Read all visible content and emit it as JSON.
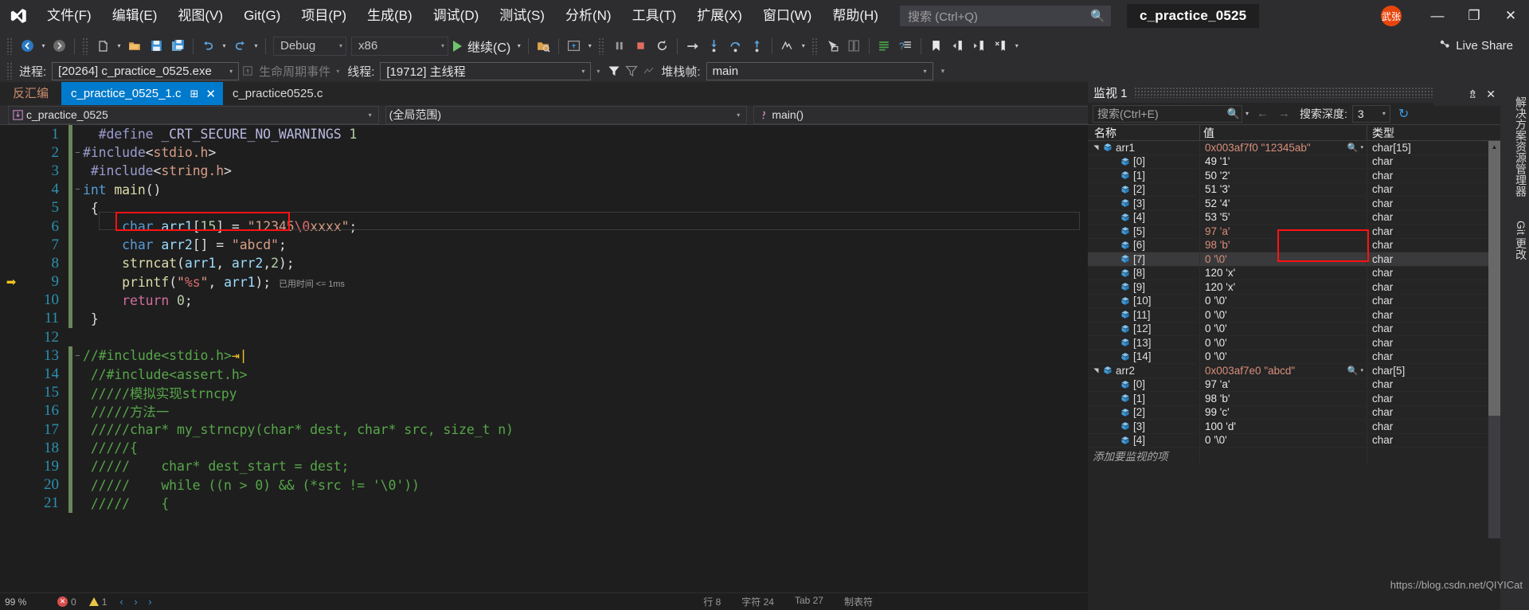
{
  "titlebar": {
    "logo": "visual-studio-logo",
    "menus": [
      "文件(F)",
      "编辑(E)",
      "视图(V)",
      "Git(G)",
      "项目(P)",
      "生成(B)",
      "调试(D)",
      "测试(S)",
      "分析(N)",
      "工具(T)",
      "扩展(X)",
      "窗口(W)",
      "帮助(H)"
    ],
    "search_placeholder": "搜索 (Ctrl+Q)",
    "project_chip": "c_practice_0525",
    "avatar_text": "武张",
    "minimize": "—",
    "restore": "❐",
    "close": "✕"
  },
  "toolbar": {
    "config": "Debug",
    "platform": "x86",
    "continue_label": "继续(C)",
    "live_share": "Live Share"
  },
  "debugbar": {
    "process_label": "进程:",
    "process_value": "[20264] c_practice_0525.exe",
    "lifecycle_label": "生命周期事件",
    "thread_label": "线程:",
    "thread_value": "[19712] 主线程",
    "stackframe_label": "堆栈帧:",
    "stackframe_value": "main"
  },
  "editor": {
    "disasm_tab": "反汇编",
    "tabs": [
      {
        "label": "c_practice_0525_1.c",
        "active": true,
        "pin": "⊞",
        "close": "✕"
      },
      {
        "label": "c_practice0525.c",
        "active": false
      }
    ],
    "nav": {
      "project": "c_practice_0525",
      "scope": "(全局范围)",
      "member": "main()"
    },
    "elapsed_hint": "已用时间 <= 1ms",
    "lines": [
      {
        "n": 1,
        "fold": "",
        "changed": true,
        "tokens": [
          [
            "k-pre",
            "  #define "
          ],
          [
            "k-macro",
            "_CRT_SECURE_NO_WARNINGS"
          ],
          [
            "k-plain",
            " "
          ],
          [
            "k-num",
            "1"
          ]
        ]
      },
      {
        "n": 2,
        "fold": "−",
        "changed": true,
        "tokens": [
          [
            "k-pre",
            "#include"
          ],
          [
            "k-plain",
            "<"
          ],
          [
            "k-inc",
            "stdio.h"
          ],
          [
            "k-plain",
            ">"
          ]
        ]
      },
      {
        "n": 3,
        "fold": "",
        "changed": true,
        "tokens": [
          [
            "k-pre",
            " #include"
          ],
          [
            "k-plain",
            "<"
          ],
          [
            "k-inc",
            "string.h"
          ],
          [
            "k-plain",
            ">"
          ]
        ]
      },
      {
        "n": 4,
        "fold": "−",
        "changed": true,
        "tokens": [
          [
            "k-type",
            "int "
          ],
          [
            "k-fn",
            "main"
          ],
          [
            "k-plain",
            "()"
          ]
        ]
      },
      {
        "n": 5,
        "fold": "",
        "changed": true,
        "tokens": [
          [
            "k-plain",
            " {"
          ]
        ]
      },
      {
        "n": 6,
        "fold": "",
        "changed": true,
        "tokens": [
          [
            "k-plain",
            "     "
          ],
          [
            "k-type",
            "char"
          ],
          [
            "k-plain",
            " "
          ],
          [
            "k-var",
            "arr1"
          ],
          [
            "k-plain",
            "["
          ],
          [
            "k-num",
            "15"
          ],
          [
            "k-plain",
            "] = "
          ],
          [
            "k-str",
            "\"12345"
          ],
          [
            "k-esc",
            "\\0"
          ],
          [
            "k-str",
            "xxxx\""
          ],
          [
            "k-plain",
            ";"
          ]
        ]
      },
      {
        "n": 7,
        "fold": "",
        "changed": true,
        "tokens": [
          [
            "k-plain",
            "     "
          ],
          [
            "k-type",
            "char"
          ],
          [
            "k-plain",
            " "
          ],
          [
            "k-var",
            "arr2"
          ],
          [
            "k-plain",
            "[] = "
          ],
          [
            "k-str",
            "\"abcd\""
          ],
          [
            "k-plain",
            ";"
          ]
        ]
      },
      {
        "n": 8,
        "fold": "",
        "changed": true,
        "tokens": [
          [
            "k-plain",
            "     "
          ],
          [
            "k-fn",
            "strncat"
          ],
          [
            "k-plain",
            "("
          ],
          [
            "k-var",
            "arr1"
          ],
          [
            "k-plain",
            ", "
          ],
          [
            "k-var",
            "arr2"
          ],
          [
            "k-plain",
            ","
          ],
          [
            "k-num",
            "2"
          ],
          [
            "k-plain",
            ");"
          ]
        ]
      },
      {
        "n": 9,
        "fold": "",
        "changed": true,
        "current": true,
        "tokens": [
          [
            "k-plain",
            "     "
          ],
          [
            "k-fn",
            "printf"
          ],
          [
            "k-plain",
            "("
          ],
          [
            "k-str",
            "\""
          ],
          [
            "k-esc",
            "%s"
          ],
          [
            "k-str",
            "\""
          ],
          [
            "k-plain",
            ", "
          ],
          [
            "k-var",
            "arr1"
          ],
          [
            "k-plain",
            ");"
          ]
        ],
        "hint": true
      },
      {
        "n": 10,
        "fold": "",
        "changed": true,
        "tokens": [
          [
            "k-plain",
            "     "
          ],
          [
            "k-kw",
            "return"
          ],
          [
            "k-plain",
            " "
          ],
          [
            "k-num",
            "0"
          ],
          [
            "k-plain",
            ";"
          ]
        ]
      },
      {
        "n": 11,
        "fold": "",
        "changed": true,
        "tokens": [
          [
            "k-plain",
            " }"
          ]
        ]
      },
      {
        "n": 12,
        "fold": "",
        "changed": false,
        "tokens": [
          [
            "k-plain",
            ""
          ]
        ]
      },
      {
        "n": 13,
        "fold": "−",
        "changed": true,
        "tokens": [
          [
            "k-cmt",
            "//#include<stdio.h>"
          ]
        ],
        "caret": true
      },
      {
        "n": 14,
        "fold": "",
        "changed": true,
        "tokens": [
          [
            "k-cmt",
            " //#include<assert.h>"
          ]
        ]
      },
      {
        "n": 15,
        "fold": "",
        "changed": true,
        "tokens": [
          [
            "k-cmt",
            " /////模拟实现strncpy"
          ]
        ]
      },
      {
        "n": 16,
        "fold": "",
        "changed": true,
        "tokens": [
          [
            "k-cmt",
            " /////方法一"
          ]
        ]
      },
      {
        "n": 17,
        "fold": "",
        "changed": true,
        "tokens": [
          [
            "k-cmt",
            " /////char* my_strncpy(char* dest, char* src, size_t n)"
          ]
        ]
      },
      {
        "n": 18,
        "fold": "",
        "changed": true,
        "tokens": [
          [
            "k-cmt",
            " /////{"
          ]
        ]
      },
      {
        "n": 19,
        "fold": "",
        "changed": true,
        "tokens": [
          [
            "k-cmt",
            " /////    char* dest_start = dest;"
          ]
        ]
      },
      {
        "n": 20,
        "fold": "",
        "changed": true,
        "tokens": [
          [
            "k-cmt",
            " /////    while ((n > 0) && (*src != '\\0'))"
          ]
        ]
      },
      {
        "n": 21,
        "fold": "",
        "changed": true,
        "tokens": [
          [
            "k-cmt",
            " /////    {"
          ]
        ]
      }
    ]
  },
  "statusbar": {
    "zoom": "99 %",
    "errors": "0",
    "warnings": "1",
    "line_label": "行 8",
    "col_label": "字符 24",
    "tabpos_label": "Tab 27",
    "encoding": "制表符"
  },
  "watch": {
    "title": "监视 1",
    "search_placeholder": "搜索(Ctrl+E)",
    "depth_label": "搜索深度:",
    "depth_value": "3",
    "columns": {
      "name": "名称",
      "value": "值",
      "type": "类型"
    },
    "add_row": "添加要监视的项",
    "rows": [
      {
        "tri": "▲",
        "indent": 0,
        "name": "arr1",
        "value": "0x003af7f0 \"12345ab\"",
        "type": "char[15]",
        "magnifier": true,
        "value_red": true
      },
      {
        "tri": "",
        "indent": 1,
        "name": "[0]",
        "value": "49 '1'",
        "type": "char"
      },
      {
        "tri": "",
        "indent": 1,
        "name": "[1]",
        "value": "50 '2'",
        "type": "char"
      },
      {
        "tri": "",
        "indent": 1,
        "name": "[2]",
        "value": "51 '3'",
        "type": "char"
      },
      {
        "tri": "",
        "indent": 1,
        "name": "[3]",
        "value": "52 '4'",
        "type": "char"
      },
      {
        "tri": "",
        "indent": 1,
        "name": "[4]",
        "value": "53 '5'",
        "type": "char"
      },
      {
        "tri": "",
        "indent": 1,
        "name": "[5]",
        "value": "97 'a'",
        "type": "char",
        "value_red": true
      },
      {
        "tri": "",
        "indent": 1,
        "name": "[6]",
        "value": "98 'b'",
        "type": "char",
        "value_red": true
      },
      {
        "tri": "",
        "indent": 1,
        "name": "[7]",
        "value": "0 '\\0'",
        "type": "char",
        "selected": true,
        "value_red": true
      },
      {
        "tri": "",
        "indent": 1,
        "name": "[8]",
        "value": "120 'x'",
        "type": "char"
      },
      {
        "tri": "",
        "indent": 1,
        "name": "[9]",
        "value": "120 'x'",
        "type": "char"
      },
      {
        "tri": "",
        "indent": 1,
        "name": "[10]",
        "value": "0 '\\0'",
        "type": "char"
      },
      {
        "tri": "",
        "indent": 1,
        "name": "[11]",
        "value": "0 '\\0'",
        "type": "char"
      },
      {
        "tri": "",
        "indent": 1,
        "name": "[12]",
        "value": "0 '\\0'",
        "type": "char"
      },
      {
        "tri": "",
        "indent": 1,
        "name": "[13]",
        "value": "0 '\\0'",
        "type": "char"
      },
      {
        "tri": "",
        "indent": 1,
        "name": "[14]",
        "value": "0 '\\0'",
        "type": "char"
      },
      {
        "tri": "▲",
        "indent": 0,
        "name": "arr2",
        "value": "0x003af7e0 \"abcd\"",
        "type": "char[5]",
        "magnifier": true,
        "value_red": true
      },
      {
        "tri": "",
        "indent": 1,
        "name": "[0]",
        "value": "97 'a'",
        "type": "char"
      },
      {
        "tri": "",
        "indent": 1,
        "name": "[1]",
        "value": "98 'b'",
        "type": "char"
      },
      {
        "tri": "",
        "indent": 1,
        "name": "[2]",
        "value": "99 'c'",
        "type": "char"
      },
      {
        "tri": "",
        "indent": 1,
        "name": "[3]",
        "value": "100 'd'",
        "type": "char"
      },
      {
        "tri": "",
        "indent": 1,
        "name": "[4]",
        "value": "0 '\\0'",
        "type": "char"
      }
    ]
  },
  "right_dock": {
    "tabs": [
      "解决方案资源管理器",
      "Git 更改"
    ]
  },
  "watermark": "https://blog.csdn.net/QIYICat",
  "colors": {
    "accent": "#007acc",
    "highlight_red": "#ff1111",
    "avatar": "#e8450c",
    "changed_bar": "#6a8759"
  }
}
